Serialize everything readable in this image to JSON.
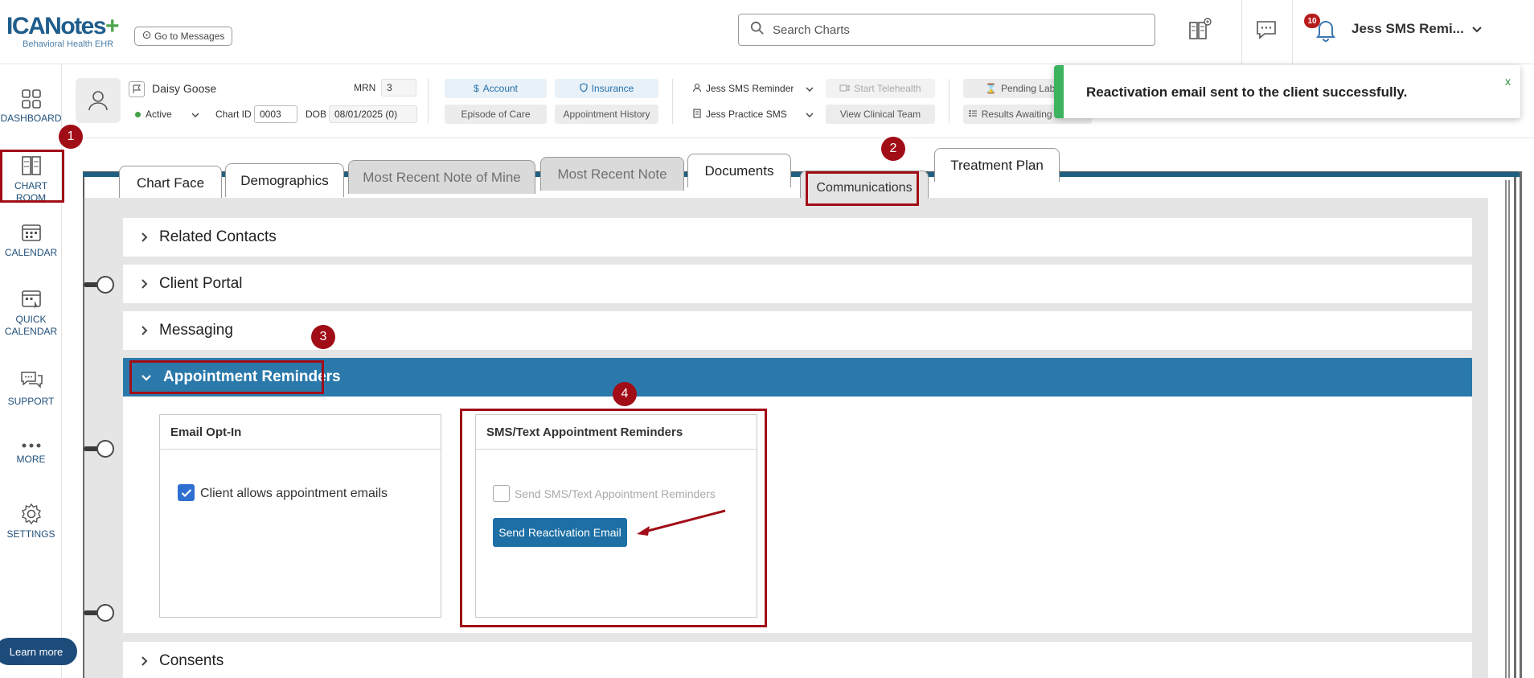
{
  "app": {
    "logo_main": "ICANotes",
    "logo_sub": "Behavioral Health EHR",
    "goto_messages": "Go to Messages",
    "search_placeholder": "Search Charts",
    "notification_count": "10",
    "user_name": "Jess SMS Remi..."
  },
  "sidebar": {
    "items": [
      {
        "label": "DASHBOARD",
        "icon": "dashboard-icon"
      },
      {
        "label": "CHART ROOM",
        "icon": "chart-room-icon"
      },
      {
        "label": "CALENDAR",
        "icon": "calendar-icon"
      },
      {
        "label": "QUICK CALENDAR",
        "icon": "quick-calendar-icon"
      },
      {
        "label": "SUPPORT",
        "icon": "support-icon"
      },
      {
        "label": "MORE",
        "icon": "more-icon"
      },
      {
        "label": "SETTINGS",
        "icon": "gear-icon"
      }
    ],
    "learn_more": "Learn more"
  },
  "patient": {
    "name": "Daisy Goose",
    "status": "Active",
    "mrn_label": "MRN",
    "mrn": "3",
    "chart_id_label": "Chart ID",
    "chart_id": "0003",
    "dob_label": "DOB",
    "dob": "08/01/2025 (0)"
  },
  "header_buttons": {
    "account": "Account",
    "insurance": "Insurance",
    "episode_of_care": "Episode of Care",
    "appointment_history": "Appointment History",
    "provider": "Jess SMS Reminder",
    "practice": "Jess Practice SMS",
    "start_telehealth": "Start Telehealth",
    "view_clinical_team": "View Clinical Team",
    "pending_lab": "Pending Lab Re",
    "results_awaiting": "Results Awaiting Review"
  },
  "toast": {
    "message": "Reactivation email sent to the client successfully.",
    "close": "x"
  },
  "tabs": [
    {
      "label": "Chart Face"
    },
    {
      "label": "Demographics"
    },
    {
      "label": "Most Recent Note of Mine"
    },
    {
      "label": "Most Recent Note"
    },
    {
      "label": "Documents"
    },
    {
      "label": "Communications"
    },
    {
      "label": "Treatment Plan"
    }
  ],
  "sections": {
    "related_contacts": "Related Contacts",
    "client_portal": "Client Portal",
    "messaging": "Messaging",
    "appointment_reminders": "Appointment Reminders",
    "consents": "Consents"
  },
  "email_card": {
    "title": "Email Opt-In",
    "checkbox_label": "Client allows appointment emails",
    "checked": true
  },
  "sms_card": {
    "title": "SMS/Text Appointment Reminders",
    "checkbox_label": "Send SMS/Text Appointment Reminders",
    "checked": false,
    "button": "Send Reactivation Email"
  },
  "annotations": [
    "1",
    "2",
    "3",
    "4"
  ],
  "colors": {
    "brand": "#1f5d8c",
    "accordion_active": "#2b79ab",
    "annotation": "#a10d17",
    "toast_success": "#3cb35e"
  }
}
